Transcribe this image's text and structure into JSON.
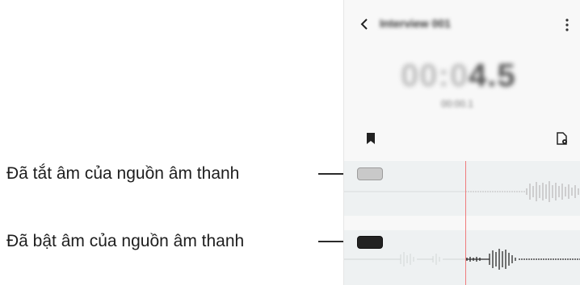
{
  "callouts": {
    "muted": "Đã tắt âm của nguồn âm thanh",
    "unmuted": "Đã bật âm của nguồn âm thanh"
  },
  "app": {
    "title": "Interview 001",
    "timer_dim": "00:0",
    "timer_strong": "4.5",
    "timer_sub": "00:00.1"
  },
  "icons": {
    "back": "chevron-left-icon",
    "more": "more-vertical-icon",
    "bookmark": "bookmark-icon",
    "file": "file-settings-icon"
  },
  "colors": {
    "track_bg": "#eef1f2",
    "playhead": "#f07c7c",
    "muted_toggle": "#c9c9c9",
    "unmuted_toggle": "#222222"
  }
}
